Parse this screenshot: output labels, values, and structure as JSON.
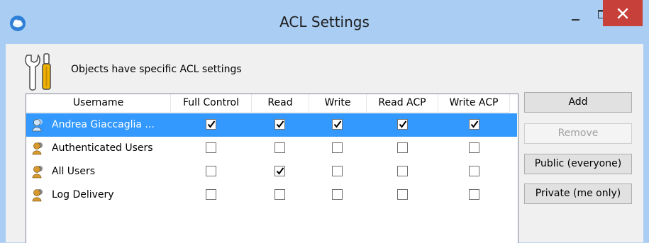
{
  "window": {
    "title": "ACL Settings",
    "close_glyph": "×"
  },
  "heading": "Objects have specific ACL settings",
  "columns": [
    "Username",
    "Full Control",
    "Read",
    "Write",
    "Read ACP",
    "Write ACP"
  ],
  "rows": [
    {
      "name": "Andrea Giaccaglia ...",
      "selected": true,
      "full_control": true,
      "read": true,
      "write": true,
      "read_acp": true,
      "write_acp": true
    },
    {
      "name": "Authenticated Users",
      "selected": false,
      "full_control": false,
      "read": false,
      "write": false,
      "read_acp": false,
      "write_acp": false
    },
    {
      "name": "All Users",
      "selected": false,
      "full_control": false,
      "read": true,
      "write": false,
      "read_acp": false,
      "write_acp": false
    },
    {
      "name": "Log Delivery",
      "selected": false,
      "full_control": false,
      "read": false,
      "write": false,
      "read_acp": false,
      "write_acp": false
    }
  ],
  "buttons": {
    "add": "Add",
    "remove": "Remove",
    "public": "Public (everyone)",
    "private": "Private (me only)"
  },
  "colors": {
    "selection": "#3399ff",
    "close": "#c7403a",
    "frame": "#a9cdf3"
  }
}
